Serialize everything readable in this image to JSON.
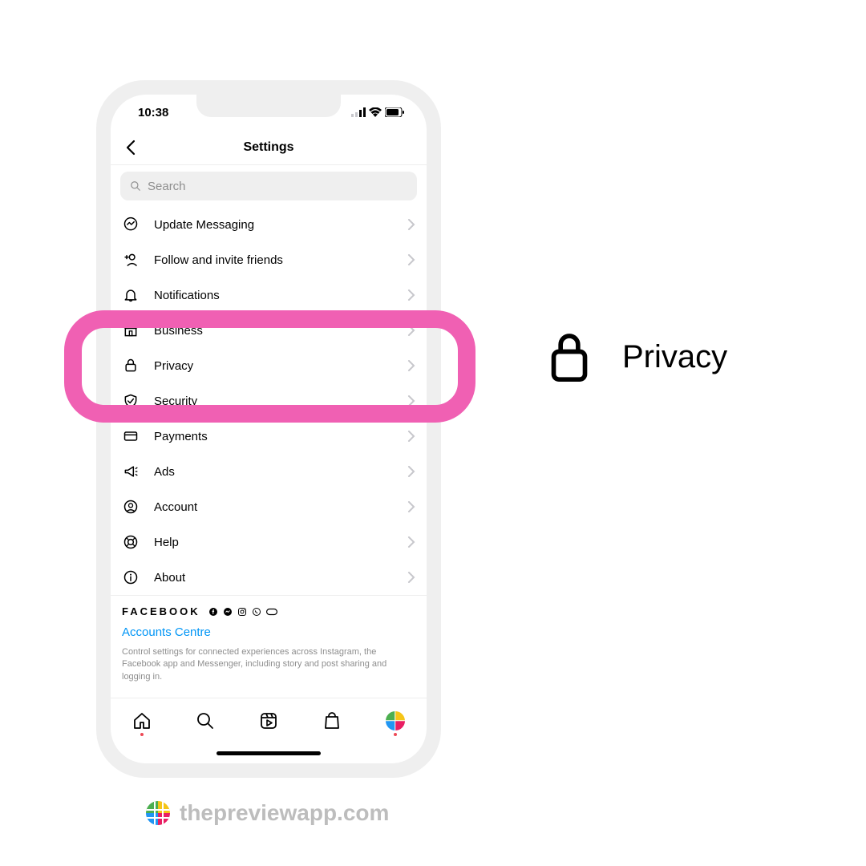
{
  "status": {
    "time": "10:38"
  },
  "header": {
    "title": "Settings"
  },
  "search": {
    "placeholder": "Search"
  },
  "rows": [
    {
      "label": "Update Messaging",
      "icon": "messenger"
    },
    {
      "label": "Follow and invite friends",
      "icon": "add-person"
    },
    {
      "label": "Notifications",
      "icon": "bell"
    },
    {
      "label": "Business",
      "icon": "shop"
    },
    {
      "label": "Privacy",
      "icon": "lock"
    },
    {
      "label": "Security",
      "icon": "shield"
    },
    {
      "label": "Payments",
      "icon": "card"
    },
    {
      "label": "Ads",
      "icon": "megaphone"
    },
    {
      "label": "Account",
      "icon": "user"
    },
    {
      "label": "Help",
      "icon": "lifebuoy"
    },
    {
      "label": "About",
      "icon": "info"
    }
  ],
  "facebook": {
    "brand": "FACEBOOK",
    "accounts_link": "Accounts Centre",
    "description": "Control settings for connected experiences across Instagram, the Facebook app and Messenger, including story and post sharing and logging in."
  },
  "callout": {
    "label": "Privacy"
  },
  "attribution": {
    "text": "thepreviewapp.com"
  }
}
